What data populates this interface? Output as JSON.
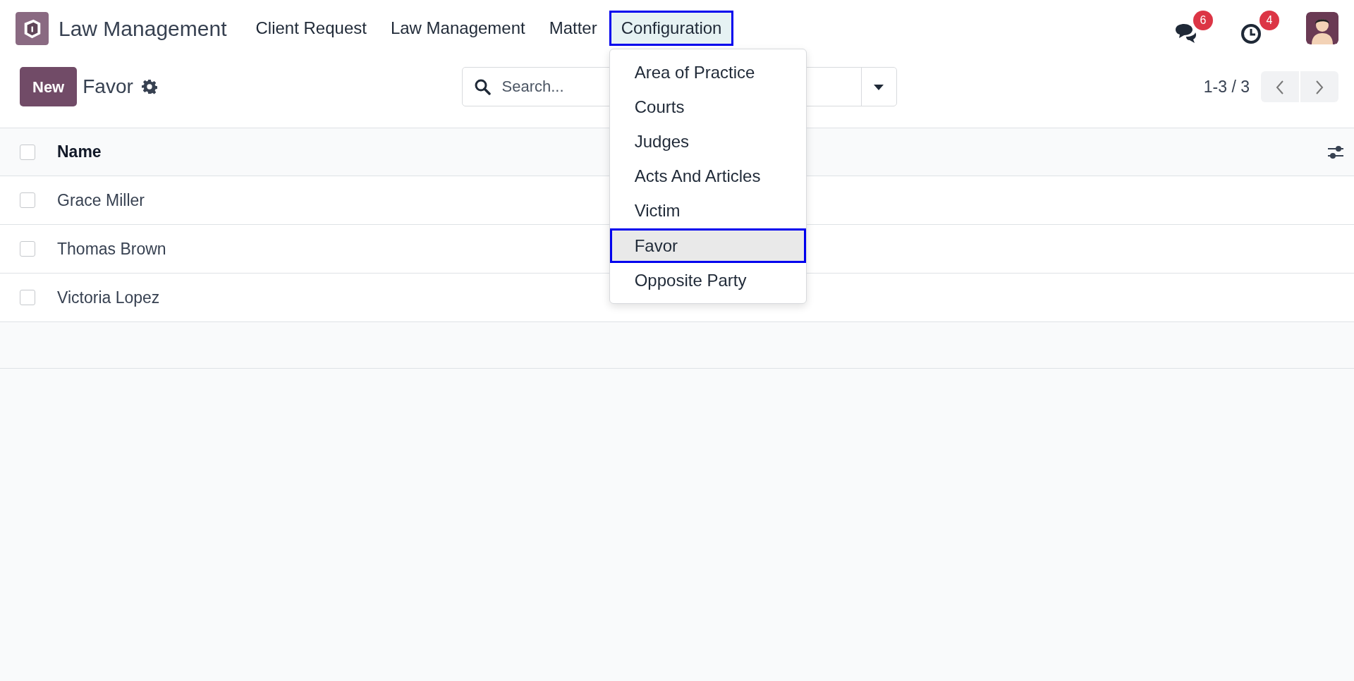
{
  "app": {
    "name": "Law Management"
  },
  "menu": [
    {
      "label": "Client Request",
      "selected": false
    },
    {
      "label": "Law Management",
      "selected": false
    },
    {
      "label": "Matter",
      "selected": false
    },
    {
      "label": "Configuration",
      "selected": true
    }
  ],
  "dropdown": [
    {
      "label": "Area of Practice",
      "selected": false
    },
    {
      "label": "Courts",
      "selected": false
    },
    {
      "label": "Judges",
      "selected": false
    },
    {
      "label": "Acts And Articles",
      "selected": false
    },
    {
      "label": "Victim",
      "selected": false
    },
    {
      "label": "Favor",
      "selected": true
    },
    {
      "label": "Opposite Party",
      "selected": false
    }
  ],
  "systray": [
    {
      "kind": "chat",
      "count": "6"
    },
    {
      "kind": "clock",
      "count": "4"
    }
  ],
  "control_panel": {
    "new_button": "New",
    "title": "Favor",
    "search": {
      "placeholder": "Search..."
    },
    "pager": "1-3 / 3"
  },
  "table": {
    "all_checked": false,
    "columns": [
      "Name"
    ],
    "rows": [
      {
        "name": "Grace Miller",
        "checked": false
      },
      {
        "name": "Thomas Brown",
        "checked": false
      },
      {
        "name": "Victoria Lopez",
        "checked": false
      }
    ]
  }
}
